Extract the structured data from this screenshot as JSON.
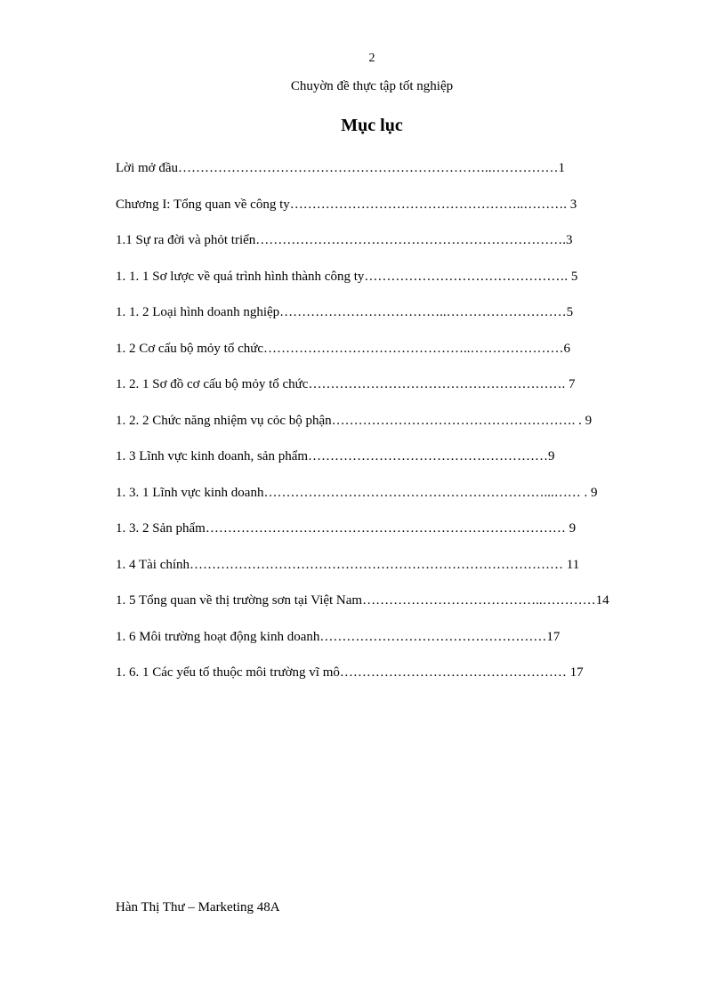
{
  "pageNumber": "2",
  "subtitle": "Chuyờn đề thực tập tốt nghiệp",
  "title": "Mục lục",
  "toc": [
    {
      "text": "Lời mở đầu……………………………………………………………..……………1"
    },
    {
      "text": "Chương I: Tổng quan về công ty……………………………………………..……….  3"
    },
    {
      "text": "1.1 Sự ra đời và phỏt triển…………………………………………………………….3"
    },
    {
      "text": "1. 1. 1 Sơ lược về quá trình hình thành công ty……………………………………….  5"
    },
    {
      "text": "1. 1. 2 Loại hình doanh nghiệp………………………………..………………………5"
    },
    {
      "text": "1. 2 Cơ cấu bộ mỏy tổ chức………………………………………..…………………6"
    },
    {
      "text": "1. 2. 1 Sơ đồ cơ cấu bộ mỏy tổ chức………………………………………………….  7"
    },
    {
      "text": "1. 2. 2 Chức năng nhiệm vụ cỏc bộ phận………………………………………………. . 9"
    },
    {
      "text": "1. 3 Lĩnh vực kinh doanh, sản phẩm………………………………………………9"
    },
    {
      "text": "1. 3. 1 Lĩnh vực kinh doanh………………………………………………………...…… . 9"
    },
    {
      "text": "1. 3. 2 Sản phẩm……………………………………………………………………… 9"
    },
    {
      "text": "1. 4 Tài chính………………………………………………………………………… 11"
    },
    {
      "text": "1. 5 Tổng quan về thị trường sơn tại Việt Nam…………………………………..…………14"
    },
    {
      "text": "1. 6 Môi trường hoạt động kinh doanh……………………………………………17"
    },
    {
      "text": "1. 6. 1 Các yếu tố thuộc môi trường vĩ mô…………………………………………… 17"
    }
  ],
  "footer": "Hàn Thị Thư – Marketing 48A"
}
